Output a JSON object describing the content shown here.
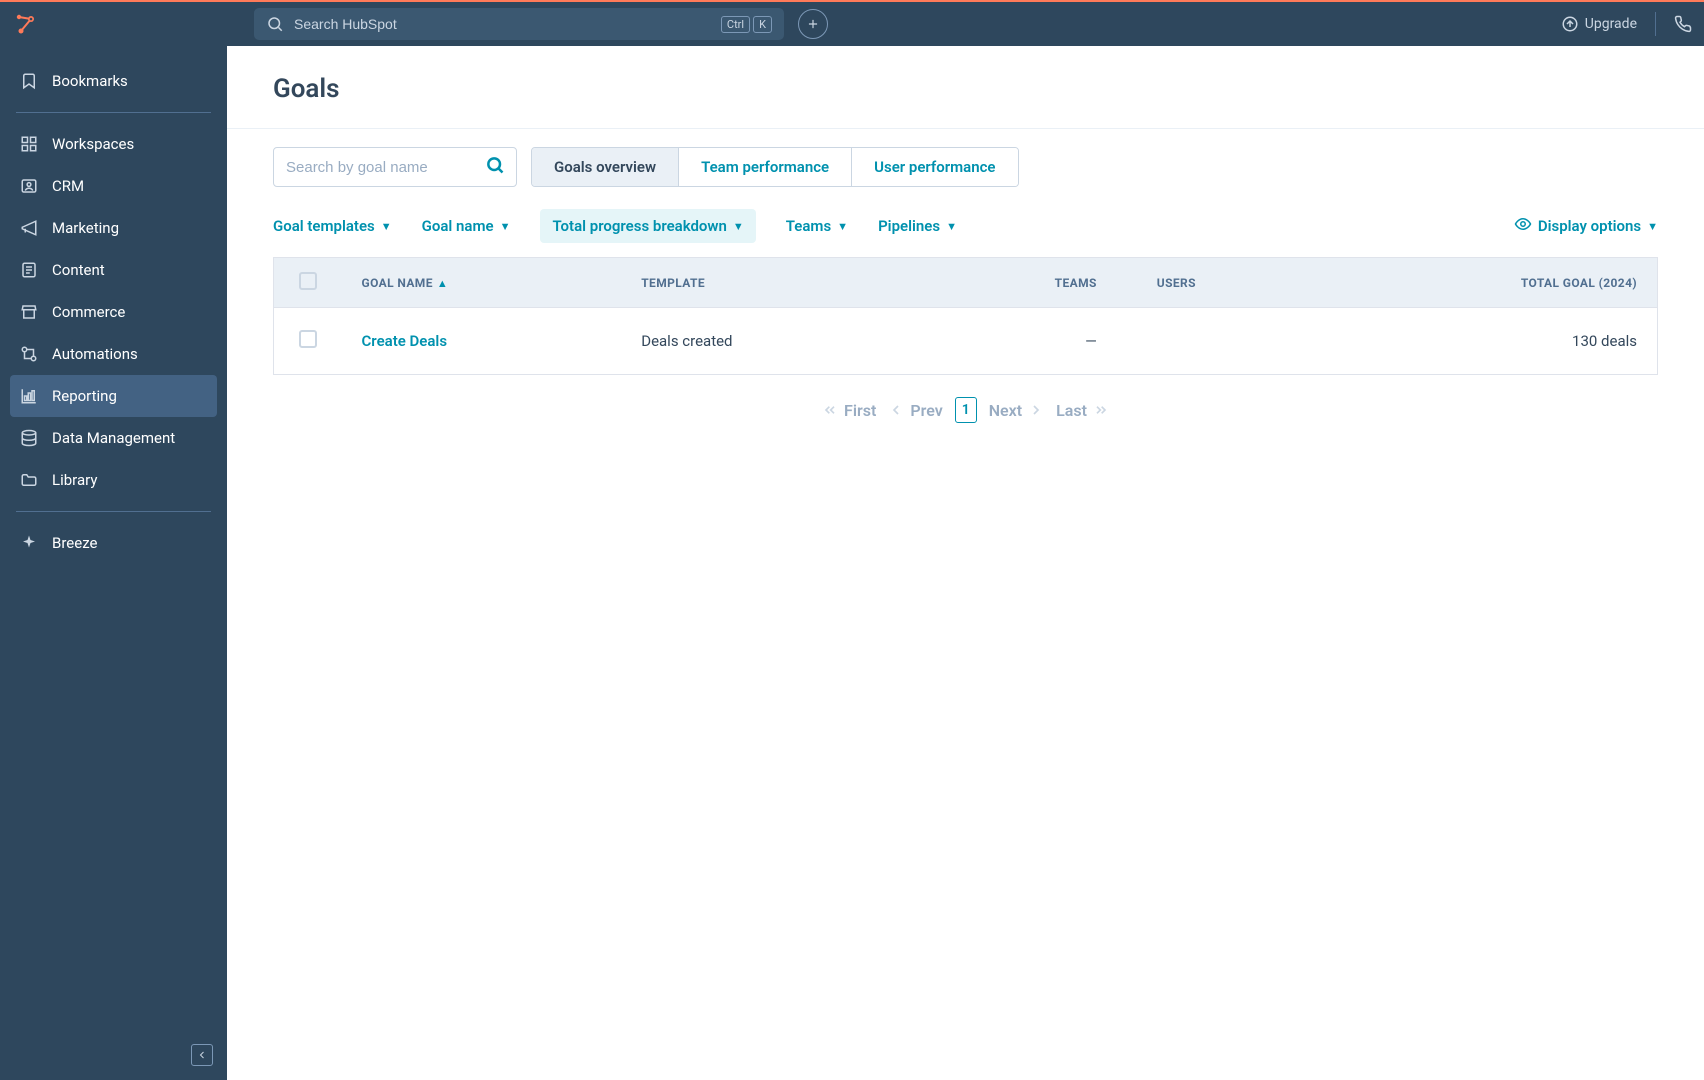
{
  "topbar": {
    "search_placeholder": "Search HubSpot",
    "shortcut_key1": "Ctrl",
    "shortcut_key2": "K",
    "upgrade_label": "Upgrade"
  },
  "sidebar": {
    "items": [
      {
        "label": "Bookmarks"
      },
      {
        "label": "Workspaces"
      },
      {
        "label": "CRM"
      },
      {
        "label": "Marketing"
      },
      {
        "label": "Content"
      },
      {
        "label": "Commerce"
      },
      {
        "label": "Automations"
      },
      {
        "label": "Reporting"
      },
      {
        "label": "Data Management"
      },
      {
        "label": "Library"
      },
      {
        "label": "Breeze"
      }
    ]
  },
  "page": {
    "title": "Goals",
    "search_placeholder": "Search by goal name"
  },
  "tabs": {
    "overview": "Goals overview",
    "team": "Team performance",
    "user": "User performance"
  },
  "filters": {
    "templates": "Goal templates",
    "goalname": "Goal name",
    "progress": "Total progress breakdown",
    "teams": "Teams",
    "pipelines": "Pipelines",
    "display": "Display options"
  },
  "table": {
    "headers": {
      "goal_name": "GOAL NAME",
      "template": "TEMPLATE",
      "teams": "TEAMS",
      "users": "USERS",
      "total": "TOTAL GOAL (2024)"
    },
    "rows": [
      {
        "name": "Create Deals",
        "template": "Deals created",
        "teams": "—",
        "users": "",
        "total": "130 deals"
      }
    ]
  },
  "pagination": {
    "first": "First",
    "prev": "Prev",
    "page": "1",
    "next": "Next",
    "last": "Last"
  }
}
